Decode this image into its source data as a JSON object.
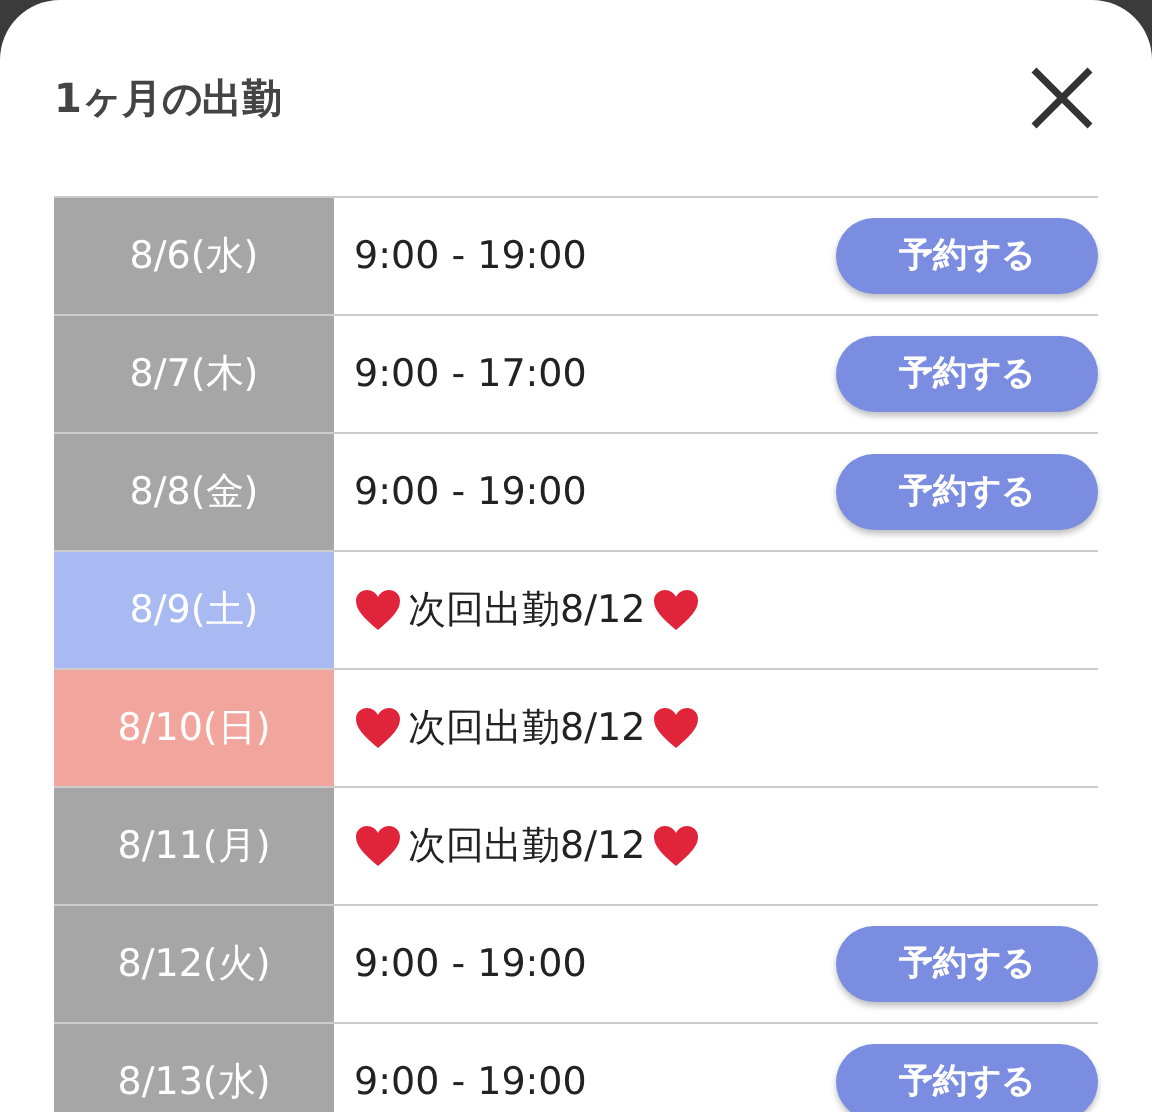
{
  "dialog": {
    "title": "1ヶ月の出勤"
  },
  "rows": [
    {
      "date": "8/6(水)",
      "color": "#a6a6a6",
      "kind": "slot",
      "time": "9:00 - 19:00",
      "button": "予約する"
    },
    {
      "date": "8/7(木)",
      "color": "#a6a6a6",
      "kind": "slot",
      "time": "9:00 - 17:00",
      "button": "予約する"
    },
    {
      "date": "8/8(金)",
      "color": "#a6a6a6",
      "kind": "slot",
      "time": "9:00 - 19:00",
      "button": "予約する"
    },
    {
      "date": "8/9(土)",
      "color": "#a9b9f2",
      "kind": "note",
      "note": "次回出勤8/12"
    },
    {
      "date": "8/10(日)",
      "color": "#f2a59d",
      "kind": "note",
      "note": "次回出勤8/12"
    },
    {
      "date": "8/11(月)",
      "color": "#a6a6a6",
      "kind": "note",
      "note": "次回出勤8/12"
    },
    {
      "date": "8/12(火)",
      "color": "#a6a6a6",
      "kind": "slot",
      "time": "9:00 - 19:00",
      "button": "予約する"
    },
    {
      "date": "8/13(水)",
      "color": "#a6a6a6",
      "kind": "slot",
      "time": "9:00 - 19:00",
      "button": "予約する"
    }
  ]
}
